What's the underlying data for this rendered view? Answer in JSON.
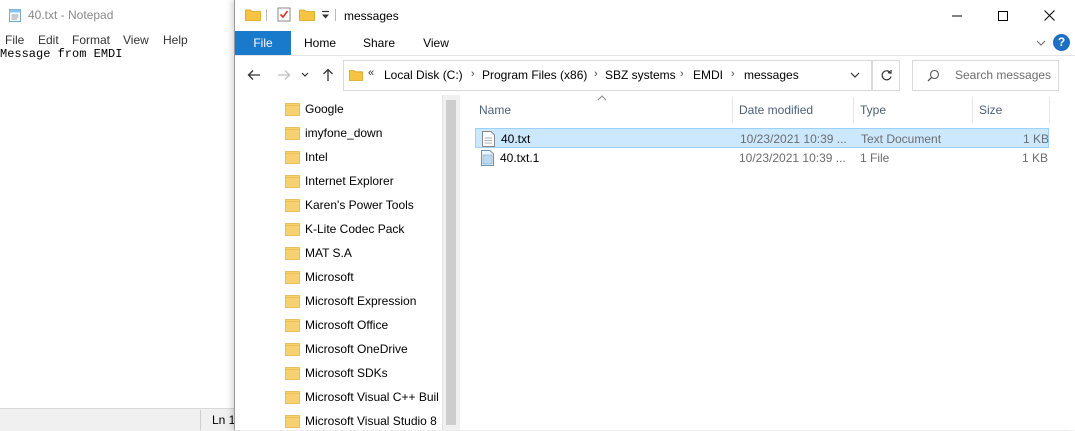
{
  "notepad": {
    "title": "40.txt - Notepad",
    "menu": [
      "File",
      "Edit",
      "Format",
      "View",
      "Help"
    ],
    "content": "Message from EMDI",
    "status_ln": "Ln 1"
  },
  "explorer": {
    "title": "messages",
    "ribbon_tabs": [
      "File",
      "Home",
      "Share",
      "View"
    ],
    "address": {
      "overflow": "«",
      "crumbs": [
        "Local Disk (C:)",
        "Program Files (x86)",
        "SBZ systems",
        "EMDI",
        "messages"
      ]
    },
    "search": {
      "placeholder": "Search messages"
    },
    "nav_items": [
      "Google",
      "imyfone_down",
      "Intel",
      "Internet Explorer",
      "Karen's Power Tools",
      "K-Lite Codec Pack",
      "MAT S.A",
      "Microsoft",
      "Microsoft Expression",
      "Microsoft Office",
      "Microsoft OneDrive",
      "Microsoft SDKs",
      "Microsoft Visual C++ Buil",
      "Microsoft Visual Studio 8"
    ],
    "columns": [
      "Name",
      "Date modified",
      "Type",
      "Size"
    ],
    "files": [
      {
        "name": "40.txt",
        "date": "10/23/2021 10:39 ...",
        "type": "Text Document",
        "size": "1 KB",
        "selected": true,
        "icon": "text-file-icon"
      },
      {
        "name": "40.txt.1",
        "date": "10/23/2021 10:39 ...",
        "type": "1 File",
        "size": "1 KB",
        "selected": false,
        "icon": "generic-file-icon"
      }
    ]
  },
  "colors": {
    "file_tab": "#1979ca",
    "selection_bg": "#cce8ff",
    "selection_border": "#99d1ff",
    "folder": "#f6c343",
    "column_header": "#4c607a"
  }
}
